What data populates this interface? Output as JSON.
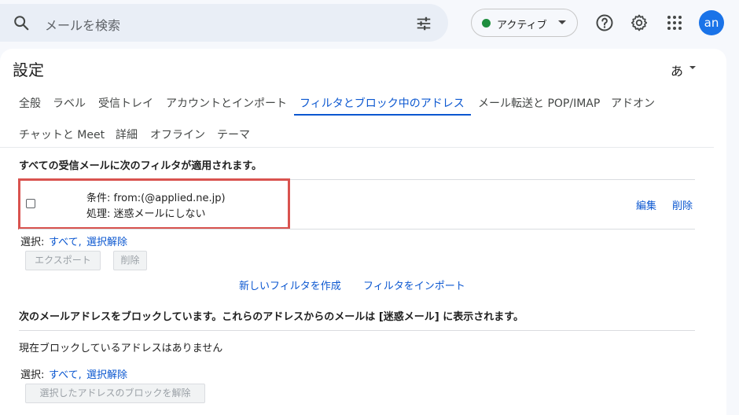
{
  "search": {
    "placeholder": "メールを検索"
  },
  "status": {
    "label": "アクティブ",
    "dot_color": "#1e8e3e"
  },
  "icons": {
    "search": "search-icon",
    "tune": "tune-icon",
    "help": "help-icon",
    "settings": "gear-icon",
    "apps": "apps-grid-icon"
  },
  "avatar": {
    "initials": "an",
    "color": "#1a73e8"
  },
  "page": {
    "title": "設定",
    "lang": "あ"
  },
  "tabs": [
    "全般",
    "ラベル",
    "受信トレイ",
    "アカウントとインポート",
    "フィルタとブロック中のアドレス",
    "メール転送と POP/IMAP",
    "アドオン",
    "チャットと Meet",
    "詳細",
    "オフライン",
    "テーマ"
  ],
  "active_tab": "フィルタとブロック中のアドレス",
  "filters": {
    "heading": "すべての受信メールに次のフィルタが適用されます。",
    "items": [
      {
        "condition": "条件: from:(@applied.ne.jp)",
        "action": "処理: 迷惑メールにしない",
        "edit": "編集",
        "delete": "削除"
      }
    ],
    "select_label": "選択:",
    "select_all": "すべて,",
    "select_none": "選択解除",
    "export_button": "エクスポート",
    "delete_button": "削除",
    "create_link": "新しいフィルタを作成",
    "import_link": "フィルタをインポート"
  },
  "blocked": {
    "heading": "次のメールアドレスをブロックしています。これらのアドレスからのメールは [迷惑メール] に表示されます。",
    "empty_text": "現在ブロックしているアドレスはありません",
    "select_label": "選択:",
    "select_all": "すべて,",
    "select_none": "選択解除",
    "unblock_button": "選択したアドレスのブロックを解除"
  },
  "highlight_color": "#d9534f",
  "accent_color": "#0b57d0"
}
